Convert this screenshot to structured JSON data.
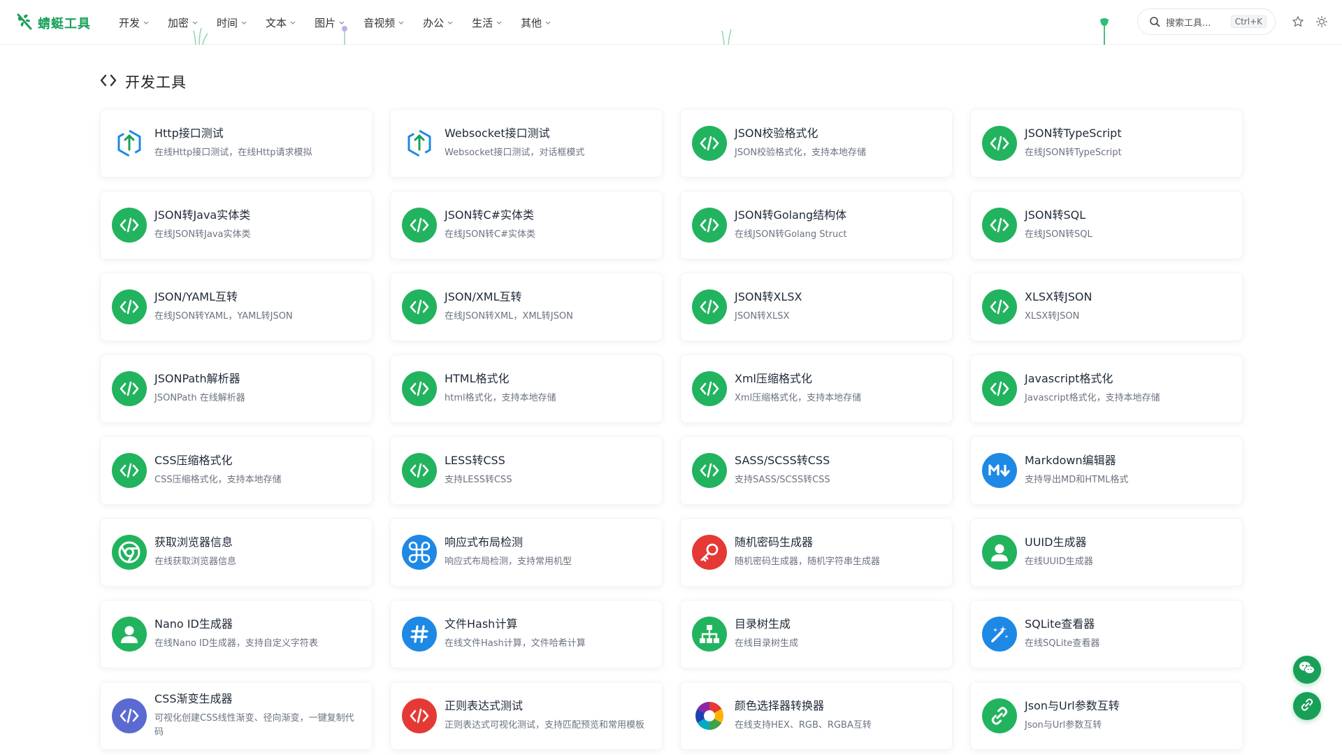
{
  "app": {
    "logo_text": "蜻蜓工具"
  },
  "nav": [
    "开发",
    "加密",
    "时间",
    "文本",
    "图片",
    "音视频",
    "办公",
    "生活",
    "其他"
  ],
  "search": {
    "placeholder": "搜索工具...",
    "shortcut": "Ctrl+K"
  },
  "section": {
    "title": "开发工具"
  },
  "colors": {
    "brand": "#18a058",
    "blue": "#1e88e5",
    "indigo": "#5b6ad0",
    "red": "#e53935"
  },
  "tools": [
    {
      "title": "Http接口测试",
      "desc": "在线Http接口测试，在线Http请求模拟",
      "icon": "upload-hex-icon",
      "color": "#ffffff"
    },
    {
      "title": "Websocket接口测试",
      "desc": "Websocket接口测试，对话框模式",
      "icon": "upload-hex-icon",
      "color": "#ffffff"
    },
    {
      "title": "JSON校验格式化",
      "desc": "JSON校验格式化，支持本地存储",
      "icon": "code-icon",
      "color": "#22b35e"
    },
    {
      "title": "JSON转TypeScript",
      "desc": "在线JSON转TypeScript",
      "icon": "code-icon",
      "color": "#22b35e"
    },
    {
      "title": "JSON转Java实体类",
      "desc": "在线JSON转Java实体类",
      "icon": "code-icon",
      "color": "#22b35e"
    },
    {
      "title": "JSON转C#实体类",
      "desc": "在线JSON转C#实体类",
      "icon": "code-icon",
      "color": "#22b35e"
    },
    {
      "title": "JSON转Golang结构体",
      "desc": "在线JSON转Golang Struct",
      "icon": "code-icon",
      "color": "#22b35e"
    },
    {
      "title": "JSON转SQL",
      "desc": "在线JSON转SQL",
      "icon": "code-icon",
      "color": "#22b35e"
    },
    {
      "title": "JSON/YAML互转",
      "desc": "在线JSON转YAML，YAML转JSON",
      "icon": "code-icon",
      "color": "#22b35e"
    },
    {
      "title": "JSON/XML互转",
      "desc": "在线JSON转XML，XML转JSON",
      "icon": "code-icon",
      "color": "#22b35e"
    },
    {
      "title": "JSON转XLSX",
      "desc": "JSON转XLSX",
      "icon": "code-icon",
      "color": "#22b35e"
    },
    {
      "title": "XLSX转JSON",
      "desc": "XLSX转JSON",
      "icon": "code-icon",
      "color": "#22b35e"
    },
    {
      "title": "JSONPath解析器",
      "desc": "JSONPath 在线解析器",
      "icon": "code-icon",
      "color": "#22b35e"
    },
    {
      "title": "HTML格式化",
      "desc": "html格式化，支持本地存储",
      "icon": "code-icon",
      "color": "#22b35e"
    },
    {
      "title": "Xml压缩格式化",
      "desc": "Xml压缩格式化，支持本地存储",
      "icon": "code-icon",
      "color": "#22b35e"
    },
    {
      "title": "Javascript格式化",
      "desc": "Javascript格式化，支持本地存储",
      "icon": "code-icon",
      "color": "#22b35e"
    },
    {
      "title": "CSS压缩格式化",
      "desc": "CSS压缩格式化，支持本地存储",
      "icon": "code-icon",
      "color": "#22b35e"
    },
    {
      "title": "LESS转CSS",
      "desc": "支持LESS转CSS",
      "icon": "code-icon",
      "color": "#22b35e"
    },
    {
      "title": "SASS/SCSS转CSS",
      "desc": "支持SASS/SCSS转CSS",
      "icon": "code-icon",
      "color": "#22b35e"
    },
    {
      "title": "Markdown编辑器",
      "desc": "支持导出MD和HTML格式",
      "icon": "markdown-icon",
      "color": "#1e88e5"
    },
    {
      "title": "获取浏览器信息",
      "desc": "在线获取浏览器信息",
      "icon": "chrome-icon",
      "color": "#22b35e"
    },
    {
      "title": "响应式布局检测",
      "desc": "响应式布局检测，支持常用机型",
      "icon": "command-icon",
      "color": "#1e88e5"
    },
    {
      "title": "随机密码生成器",
      "desc": "随机密码生成器，随机字符串生成器",
      "icon": "key-icon",
      "color": "#e53935"
    },
    {
      "title": "UUID生成器",
      "desc": "在线UUID生成器",
      "icon": "user-icon",
      "color": "#22b35e"
    },
    {
      "title": "Nano ID生成器",
      "desc": "在线Nano ID生成器，支持自定义字符表",
      "icon": "user-icon",
      "color": "#22b35e"
    },
    {
      "title": "文件Hash计算",
      "desc": "在线文件Hash计算，文件哈希计算",
      "icon": "hash-icon",
      "color": "#1e88e5"
    },
    {
      "title": "目录树生成",
      "desc": "在线目录树生成",
      "icon": "sitemap-icon",
      "color": "#22b35e"
    },
    {
      "title": "SQLite查看器",
      "desc": "在线SQLite查看器",
      "icon": "magic-wand-icon",
      "color": "#1e88e5"
    },
    {
      "title": "CSS渐变生成器",
      "desc": "可视化创建CSS线性渐变、径向渐变，一键复制代码",
      "icon": "code-icon",
      "color": "#5b6ad0"
    },
    {
      "title": "正则表达式测试",
      "desc": "正则表达式可视化测试，支持匹配预览和常用模板",
      "icon": "code-icon",
      "color": "#e53935"
    },
    {
      "title": "颜色选择器转换器",
      "desc": "在线支持HEX、RGB、RGBA互转",
      "icon": "color-wheel-icon",
      "color": "#ffffff"
    },
    {
      "title": "Json与Url参数互转",
      "desc": "Json与Url参数互转",
      "icon": "link-icon",
      "color": "#22b35e"
    }
  ]
}
